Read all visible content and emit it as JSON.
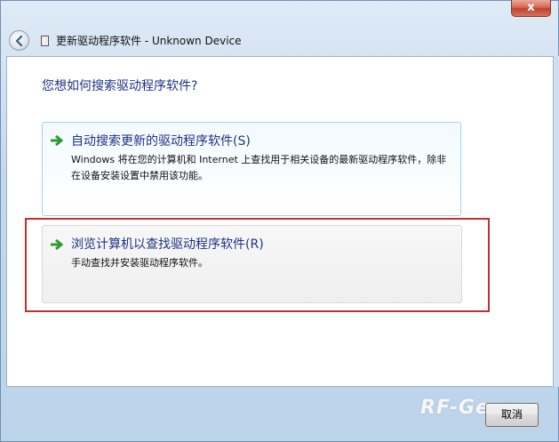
{
  "window": {
    "title": "更新驱动程序软件 - Unknown Device",
    "close_label": "x"
  },
  "main": {
    "question": "您想如何搜索驱动程序软件?",
    "options": [
      {
        "title": "自动搜索更新的驱动程序软件(S)",
        "description": "Windows 将在您的计算机和 Internet 上查找用于相关设备的最新驱动程序软件，除非在设备安装设置中禁用该功能。"
      },
      {
        "title": "浏览计算机以查找驱动程序软件(R)",
        "description": "手动查找并安装驱动程序软件。"
      }
    ]
  },
  "footer": {
    "cancel_label": "取消",
    "watermark": "RF-Gear"
  },
  "colors": {
    "accent_text": "#1e3287",
    "arrow_green": "#2e9b2e",
    "highlight_red": "#c03030"
  }
}
